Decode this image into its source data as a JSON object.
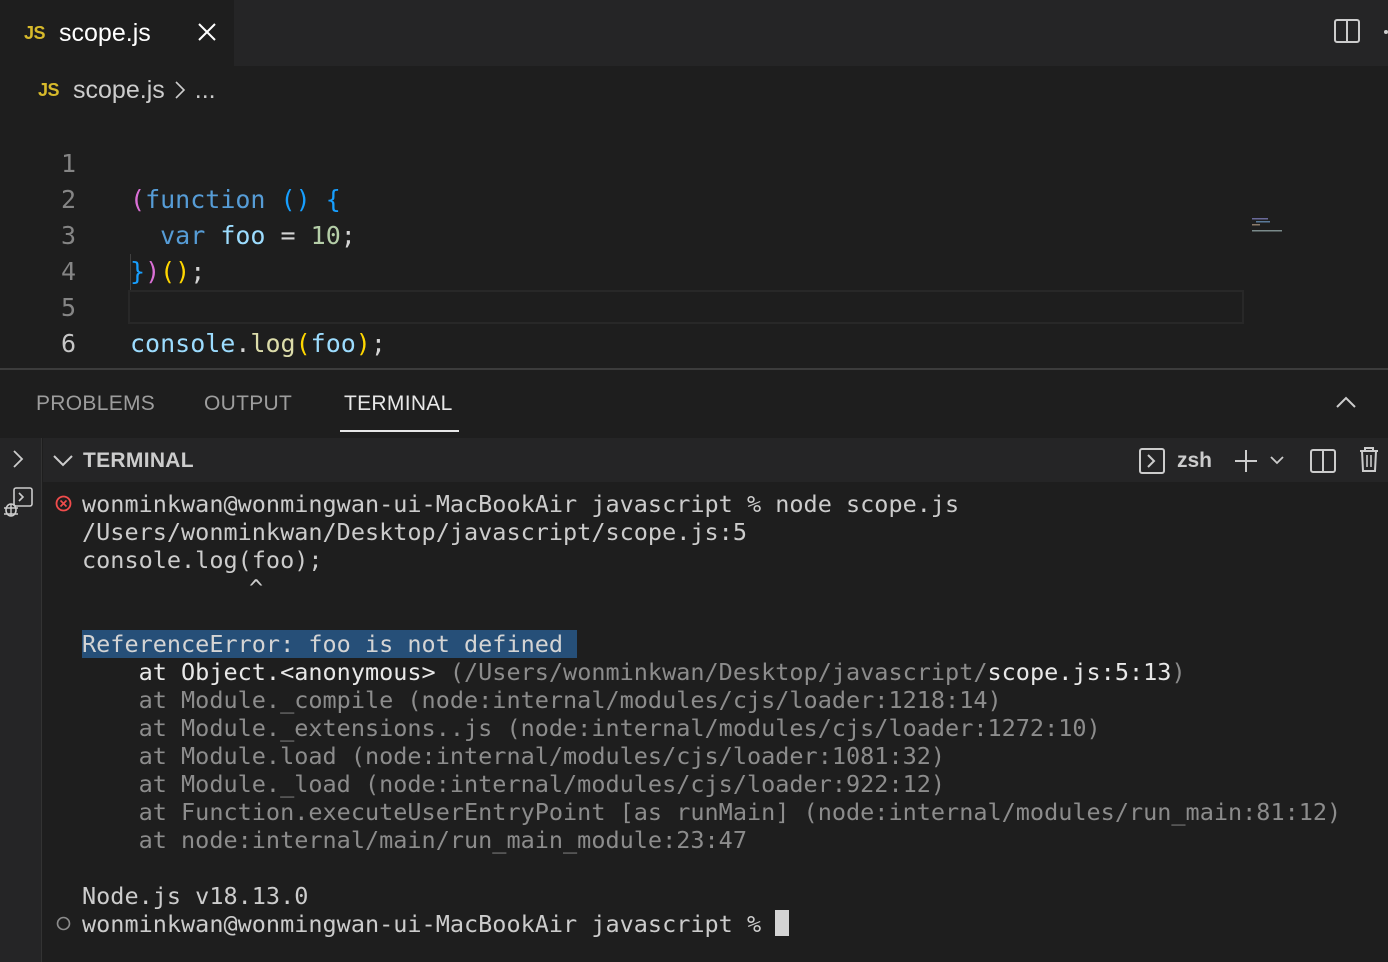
{
  "tab": {
    "badge": "JS",
    "label": "scope.js"
  },
  "breadcrumb": {
    "badge": "JS",
    "file": "scope.js",
    "more": "..."
  },
  "editor": {
    "line_numbers": [
      "1",
      "2",
      "3",
      "4",
      "5",
      "6"
    ],
    "active_line": "6"
  },
  "panel": {
    "tabs": [
      "PROBLEMS",
      "OUTPUT",
      "TERMINAL"
    ],
    "active_tab": "TERMINAL",
    "terminal_header": "TERMINAL",
    "shell": "zsh"
  },
  "terminal": {
    "prompt1": "wonminkwan@wonmingwan-ui-MacBookAir javascript % node scope.js",
    "path": "/Users/wonminkwan/Desktop/javascript/scope.js:5",
    "source": "console.log(foo);",
    "caret": "^",
    "error": "ReferenceError: foo is not defined",
    "stack0_prefix": "    at Object.<anonymous> ",
    "stack0_path": "(/Users/wonminkwan/Desktop/javascript/",
    "stack0_file": "scope.js:5:13",
    "stack0_close": ")",
    "stack": [
      "    at Module._compile (node:internal/modules/cjs/loader:1218:14)",
      "    at Module._extensions..js (node:internal/modules/cjs/loader:1272:10)",
      "    at Module.load (node:internal/modules/cjs/loader:1081:32)",
      "    at Module._load (node:internal/modules/cjs/loader:922:12)",
      "    at Function.executeUserEntryPoint [as runMain] (node:internal/modules/run_main:81:12)",
      "    at node:internal/main/run_main_module:23:47"
    ],
    "version": "Node.js v18.13.0",
    "prompt2": "wonminkwan@wonmingwan-ui-MacBookAir javascript % "
  },
  "colors": {
    "accent_js": "#d7ba2b",
    "selection": "#264f78",
    "error": "#f14c4c"
  }
}
